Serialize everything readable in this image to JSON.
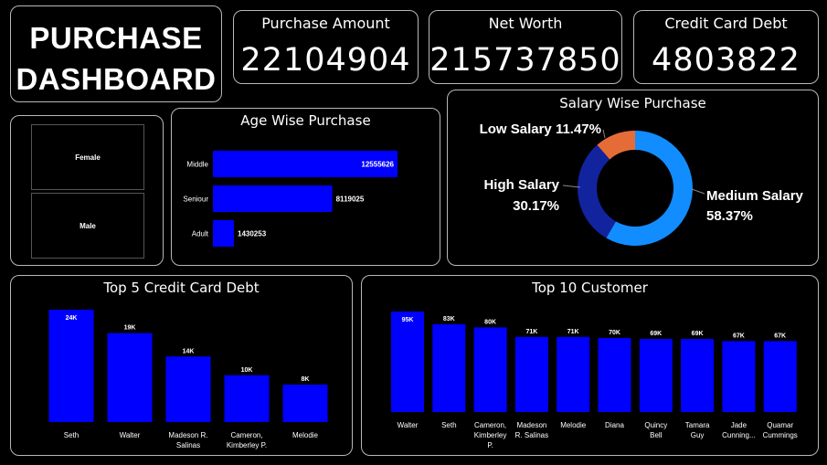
{
  "title": {
    "line1": "PURCHASE",
    "line2": "DASHBOARD"
  },
  "kpis": [
    {
      "label": "Purchase Amount",
      "value": "22104904"
    },
    {
      "label": "Net Worth",
      "value": "215737850"
    },
    {
      "label": "Credit Card Debt",
      "value": "4803822"
    }
  ],
  "gender_slicer": [
    "Female",
    "Male"
  ],
  "colors": {
    "bar": "#0000ff",
    "medium": "#118dff",
    "high": "#12239e",
    "low": "#e66c37"
  },
  "chart_data": [
    {
      "id": "age",
      "type": "bar",
      "orientation": "horizontal",
      "title": "Age Wise Purchase",
      "categories": [
        "Middle",
        "Seniour",
        "Adult"
      ],
      "values": [
        12555626,
        8119025,
        1430253
      ],
      "labels": [
        "12555626",
        "8119025",
        "1430253"
      ]
    },
    {
      "id": "salary",
      "type": "pie",
      "title": "Salary Wise Purchase",
      "slices": [
        {
          "name": "Medium Salary",
          "value": 58.37,
          "label": "58.37%"
        },
        {
          "name": "High Salary",
          "value": 30.17,
          "label": "30.17%"
        },
        {
          "name": "Low Salary",
          "value": 11.47,
          "label": "11.47%"
        }
      ]
    },
    {
      "id": "debt",
      "type": "bar",
      "title": "Top 5 Credit Card Debt",
      "categories": [
        [
          "Seth"
        ],
        [
          "Walter"
        ],
        [
          "Madeson R.",
          "Salinas"
        ],
        [
          "Cameron,",
          "Kimberley P."
        ],
        [
          "Melodie"
        ]
      ],
      "values": [
        24,
        19,
        14,
        10,
        8
      ],
      "labels": [
        "24K",
        "19K",
        "14K",
        "10K",
        "8K"
      ]
    },
    {
      "id": "customer",
      "type": "bar",
      "title": "Top 10 Customer",
      "categories": [
        [
          "Walter"
        ],
        [
          "Seth"
        ],
        [
          "Cameron,",
          "Kimberley",
          "P."
        ],
        [
          "Madeson",
          "R. Salinas"
        ],
        [
          "Melodie"
        ],
        [
          "Diana"
        ],
        [
          "Quincy",
          "Bell"
        ],
        [
          "Tamara",
          "Guy"
        ],
        [
          "Jade",
          "Cunning..."
        ],
        [
          "Quamar",
          "Cummings"
        ]
      ],
      "values": [
        95,
        83,
        80,
        71,
        71,
        70,
        69,
        69,
        67,
        67
      ],
      "labels": [
        "95K",
        "83K",
        "80K",
        "71K",
        "71K",
        "70K",
        "69K",
        "69K",
        "67K",
        "67K"
      ]
    }
  ]
}
